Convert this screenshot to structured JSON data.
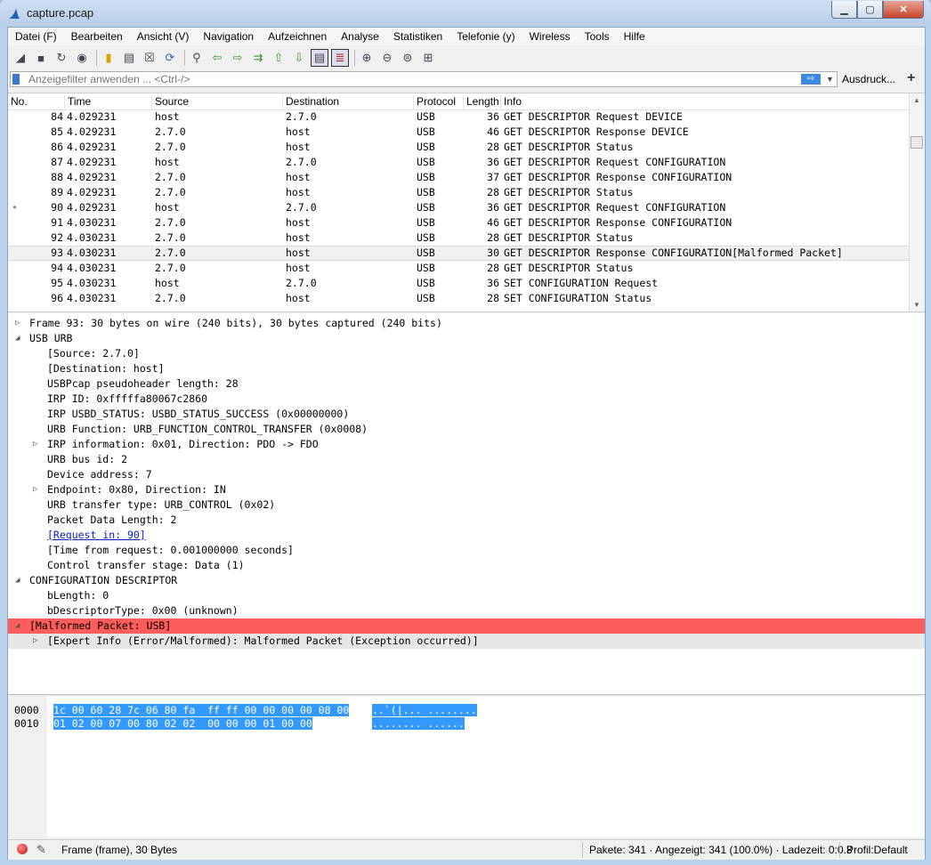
{
  "window": {
    "title": "capture.pcap",
    "min_icon": "minimize-icon",
    "max_icon": "maximize-icon",
    "close_icon": "close-icon"
  },
  "menu": [
    "Datei (F)",
    "Bearbeiten",
    "Ansicht (V)",
    "Navigation",
    "Aufzeichnen",
    "Analyse",
    "Statistiken",
    "Telefonie (y)",
    "Wireless",
    "Tools",
    "Hilfe"
  ],
  "filter": {
    "placeholder": "Anzeigefilter anwenden ... <Ctrl-/>",
    "apply_label": "⇨",
    "expressions_label": "Ausdruck...",
    "add_label": "+"
  },
  "packet_list": {
    "columns": [
      "No.",
      "Time",
      "Source",
      "Destination",
      "Protocol",
      "Length",
      "Info"
    ],
    "rows": [
      {
        "no": "84",
        "time": "4.029231",
        "src": "host",
        "dst": "2.7.0",
        "proto": "USB",
        "len": "36",
        "info": "GET DESCRIPTOR Request DEVICE"
      },
      {
        "no": "85",
        "time": "4.029231",
        "src": "2.7.0",
        "dst": "host",
        "proto": "USB",
        "len": "46",
        "info": "GET DESCRIPTOR Response DEVICE"
      },
      {
        "no": "86",
        "time": "4.029231",
        "src": "2.7.0",
        "dst": "host",
        "proto": "USB",
        "len": "28",
        "info": "GET DESCRIPTOR Status"
      },
      {
        "no": "87",
        "time": "4.029231",
        "src": "host",
        "dst": "2.7.0",
        "proto": "USB",
        "len": "36",
        "info": "GET DESCRIPTOR Request CONFIGURATION"
      },
      {
        "no": "88",
        "time": "4.029231",
        "src": "2.7.0",
        "dst": "host",
        "proto": "USB",
        "len": "37",
        "info": "GET DESCRIPTOR Response CONFIGURATION"
      },
      {
        "no": "89",
        "time": "4.029231",
        "src": "2.7.0",
        "dst": "host",
        "proto": "USB",
        "len": "28",
        "info": "GET DESCRIPTOR Status"
      },
      {
        "no": "90",
        "time": "4.029231",
        "src": "host",
        "dst": "2.7.0",
        "proto": "USB",
        "len": "36",
        "info": "GET DESCRIPTOR Request CONFIGURATION"
      },
      {
        "no": "91",
        "time": "4.030231",
        "src": "2.7.0",
        "dst": "host",
        "proto": "USB",
        "len": "46",
        "info": "GET DESCRIPTOR Response CONFIGURATION"
      },
      {
        "no": "92",
        "time": "4.030231",
        "src": "2.7.0",
        "dst": "host",
        "proto": "USB",
        "len": "28",
        "info": "GET DESCRIPTOR Status"
      },
      {
        "no": "93",
        "time": "4.030231",
        "src": "2.7.0",
        "dst": "host",
        "proto": "USB",
        "len": "30",
        "info": "GET DESCRIPTOR Response CONFIGURATION[Malformed Packet]"
      },
      {
        "no": "94",
        "time": "4.030231",
        "src": "2.7.0",
        "dst": "host",
        "proto": "USB",
        "len": "28",
        "info": "GET DESCRIPTOR Status"
      },
      {
        "no": "95",
        "time": "4.030231",
        "src": "host",
        "dst": "2.7.0",
        "proto": "USB",
        "len": "36",
        "info": "SET CONFIGURATION Request"
      },
      {
        "no": "96",
        "time": "4.030231",
        "src": "2.7.0",
        "dst": "host",
        "proto": "USB",
        "len": "28",
        "info": "SET CONFIGURATION Status"
      }
    ],
    "selected_row": 9,
    "related_marker_row": 6
  },
  "details": [
    {
      "text": "Frame 93: 30 bytes on wire (240 bits), 30 bytes captured (240 bits)",
      "level": 0,
      "expander": "collapsed"
    },
    {
      "text": "USB URB",
      "level": 0,
      "expander": "expanded"
    },
    {
      "text": "[Source: 2.7.0]",
      "level": 2,
      "expander": "none"
    },
    {
      "text": "[Destination: host]",
      "level": 2,
      "expander": "none"
    },
    {
      "text": "USBPcap pseudoheader length: 28",
      "level": 2,
      "expander": "none"
    },
    {
      "text": "IRP ID: 0xfffffa80067c2860",
      "level": 2,
      "expander": "none"
    },
    {
      "text": "IRP USBD_STATUS: USBD_STATUS_SUCCESS (0x00000000)",
      "level": 2,
      "expander": "none"
    },
    {
      "text": "URB Function: URB_FUNCTION_CONTROL_TRANSFER (0x0008)",
      "level": 2,
      "expander": "none"
    },
    {
      "text": "IRP information: 0x01, Direction: PDO -> FDO",
      "level": 2,
      "expander": "collapsed"
    },
    {
      "text": "URB bus id: 2",
      "level": 2,
      "expander": "none"
    },
    {
      "text": "Device address: 7",
      "level": 2,
      "expander": "none"
    },
    {
      "text": "Endpoint: 0x80, Direction: IN",
      "level": 2,
      "expander": "collapsed"
    },
    {
      "text": "URB transfer type: URB_CONTROL (0x02)",
      "level": 2,
      "expander": "none"
    },
    {
      "text": "Packet Data Length: 2",
      "level": 2,
      "expander": "none"
    },
    {
      "text": "[Request in: 90]",
      "level": 2,
      "expander": "none",
      "link": true
    },
    {
      "text": "[Time from request: 0.001000000 seconds]",
      "level": 2,
      "expander": "none"
    },
    {
      "text": "Control transfer stage: Data (1)",
      "level": 2,
      "expander": "none"
    },
    {
      "text": "CONFIGURATION DESCRIPTOR",
      "level": 0,
      "expander": "expanded"
    },
    {
      "text": "bLength: 0",
      "level": 2,
      "expander": "none"
    },
    {
      "text": "bDescriptorType: 0x00 (unknown)",
      "level": 2,
      "expander": "none"
    },
    {
      "text": "[Malformed Packet: USB]",
      "level": 0,
      "expander": "expanded",
      "style": "error"
    },
    {
      "text": "[Expert Info (Error/Malformed): Malformed Packet (Exception occurred)]",
      "level": 2,
      "expander": "collapsed",
      "style": "errchild"
    }
  ],
  "hex": [
    {
      "offset": "0000",
      "bytes": "1c 00 60 28 7c 06 80 fa  ff ff 00 00 00 00 08 00",
      "ascii": "..`(|... ........"
    },
    {
      "offset": "0010",
      "bytes": "01 02 00 07 00 80 02 02  00 00 00 01 00 00",
      "ascii": "........ ......"
    }
  ],
  "status": {
    "frame_info": "Frame (frame), 30 Bytes",
    "packets": "Pakete: 341 · Angezeigt: 341 (100.0%) · Ladezeit: 0:0.3",
    "profile": "Profil:Default"
  },
  "colors": {
    "error_row": "#ff5c5c",
    "selection": "#3399ff",
    "link": "#0a1fbd"
  },
  "toolbar_icons": [
    "shark-fin-start-icon",
    "stop-icon",
    "restart-icon",
    "options-gear-icon",
    "open-file-icon",
    "save-file-icon",
    "close-file-icon",
    "reload-icon",
    "find-icon",
    "back-icon",
    "forward-icon",
    "goto-packet-icon",
    "first-packet-icon",
    "last-packet-icon",
    "autoscroll-icon",
    "colorize-icon",
    "zoom-in-icon",
    "zoom-out-icon",
    "normal-size-icon",
    "resize-columns-icon"
  ]
}
